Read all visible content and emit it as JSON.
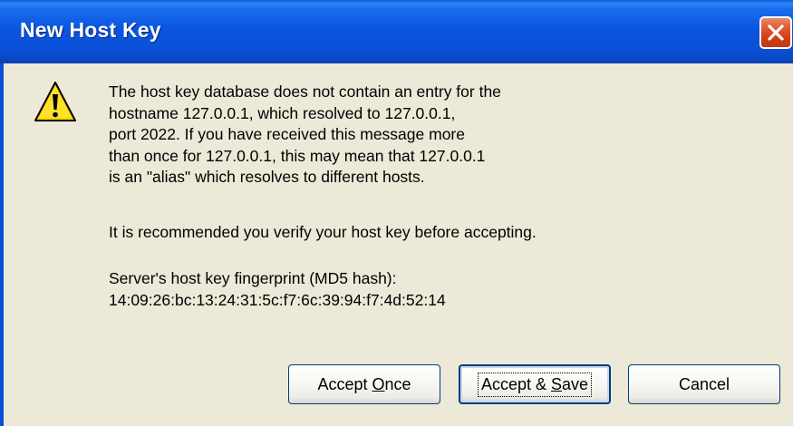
{
  "window": {
    "title": "New Host Key"
  },
  "icons": {
    "warning": "warning-icon",
    "close": "close-icon"
  },
  "message": {
    "lines": [
      "The host key database does not contain an entry for the",
      "hostname 127.0.0.1, which resolved to 127.0.0.1,",
      "port 2022.  If you have received this message more",
      "than once for 127.0.0.1, this may mean that 127.0.0.1",
      "is an \"alias\" which resolves to different hosts."
    ],
    "recommendation": "It is recommended you verify your host key before accepting.",
    "fingerprint_label": "Server's host key fingerprint (MD5 hash):",
    "fingerprint_value": "14:09:26:bc:13:24:31:5c:f7:6c:39:94:f7:4d:52:14"
  },
  "buttons": {
    "accept_once": {
      "pre": "Accept ",
      "accel": "O",
      "post": "nce"
    },
    "accept_save": {
      "pre": "Accept & ",
      "accel": "S",
      "post": "ave"
    },
    "cancel": {
      "label": "Cancel"
    }
  },
  "colors": {
    "titlebar": "#0a51d8",
    "dialog_bg": "#ece9d8",
    "close_button": "#cf3d12",
    "warning_yellow": "#ffd800"
  }
}
